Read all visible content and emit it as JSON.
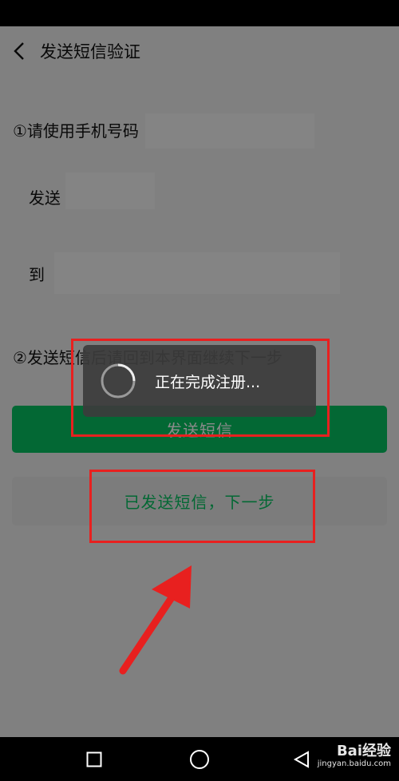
{
  "nav": {
    "title": "发送短信验证",
    "back_icon": "chevron-left-icon"
  },
  "steps": {
    "step1": "①请使用手机号码",
    "send_label": "发送",
    "to_label": "到",
    "step2": "②发送短信后请回到本界面继续下一步"
  },
  "buttons": {
    "send_sms": "发送短信",
    "sent_next": "已发送短信，下一步"
  },
  "toast": {
    "text": "正在完成注册..."
  },
  "watermark": {
    "main": "Bai经验",
    "sub": "jingyan.baidu.com"
  },
  "colors": {
    "accent": "#07c160",
    "highlight": "#e8201f"
  }
}
